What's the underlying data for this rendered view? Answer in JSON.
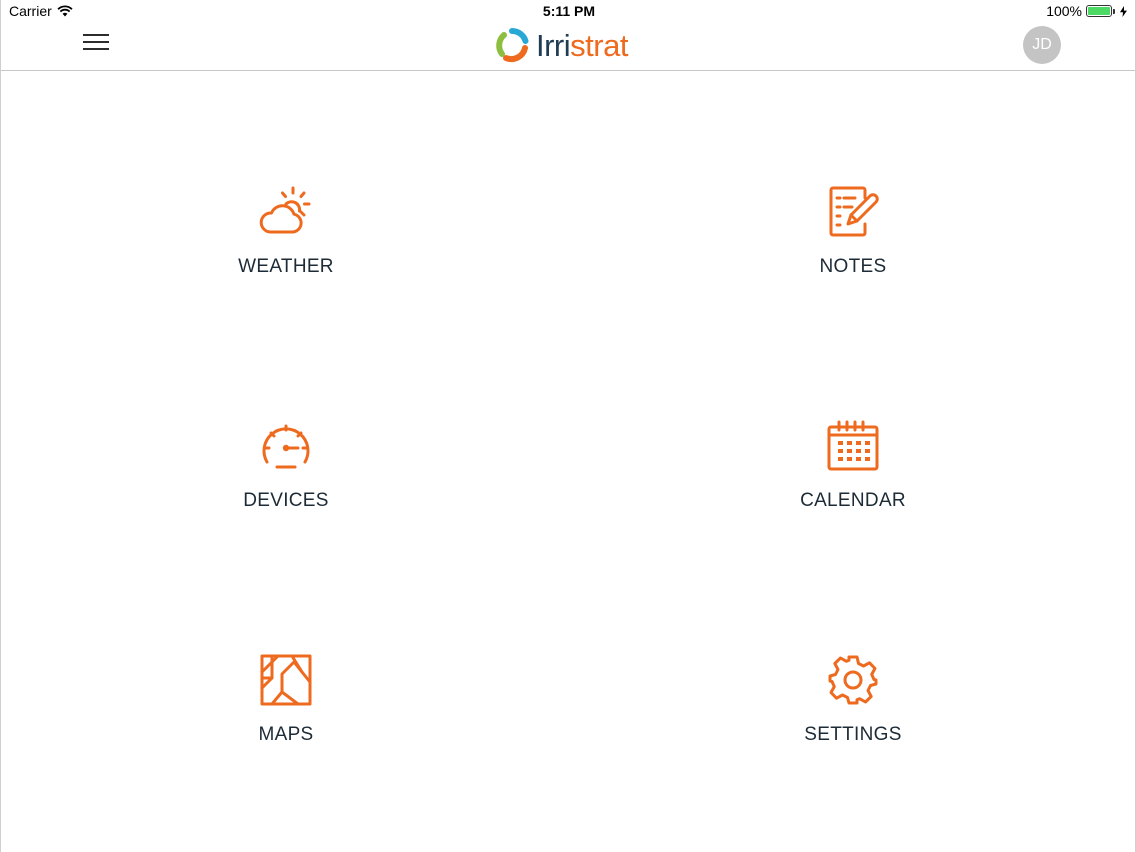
{
  "status_bar": {
    "carrier": "Carrier",
    "time": "5:11 PM",
    "battery_percent": "100%",
    "battery_level": 1.0,
    "icons": [
      "wifi-icon",
      "battery-icon",
      "charging-bolt-icon"
    ]
  },
  "nav": {
    "menu_icon": "hamburger-menu-icon",
    "logo_text_part1": "Irri",
    "logo_text_part2": "strat",
    "avatar_initials": "JD"
  },
  "colors": {
    "accent": "#ee6a1f",
    "logo_dark": "#1f3c52",
    "label_text": "#1d2b36",
    "avatar_bg": "#c4c4c4"
  },
  "tiles": [
    {
      "label": "WEATHER",
      "icon": "weather-partly-sunny-icon"
    },
    {
      "label": "NOTES",
      "icon": "notes-edit-icon"
    },
    {
      "label": "DEVICES",
      "icon": "gauge-icon"
    },
    {
      "label": "CALENDAR",
      "icon": "calendar-icon"
    },
    {
      "label": "MAPS",
      "icon": "map-icon"
    },
    {
      "label": "SETTINGS",
      "icon": "gear-icon"
    }
  ]
}
